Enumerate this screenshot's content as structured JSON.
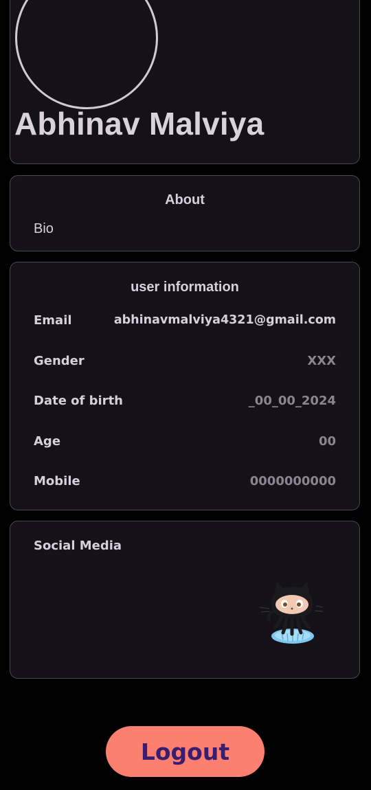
{
  "profile": {
    "name": "Abhinav Malviya"
  },
  "about": {
    "title": "About",
    "bio": "Bio"
  },
  "user_information": {
    "title": "user information",
    "rows": [
      {
        "label": "Email",
        "value": "abhinavmalviya4321@gmail.com"
      },
      {
        "label": "Gender",
        "value": "XXX"
      },
      {
        "label": "Date of birth",
        "value": "_00_00_2024"
      },
      {
        "label": "Age",
        "value": "00"
      },
      {
        "label": "Mobile",
        "value": "0000000000"
      }
    ]
  },
  "social_media": {
    "title": "Social Media",
    "links": [
      {
        "icon": "github-octocat-icon"
      }
    ]
  },
  "logout": {
    "label": "Logout"
  },
  "colors": {
    "background": "#000000",
    "card": "#141218",
    "card_border": "#4a4752",
    "text": "#d7d0dc",
    "muted_value": "#8a8590",
    "logout_bg": "#fb8070",
    "logout_text": "#3a1d6e"
  }
}
